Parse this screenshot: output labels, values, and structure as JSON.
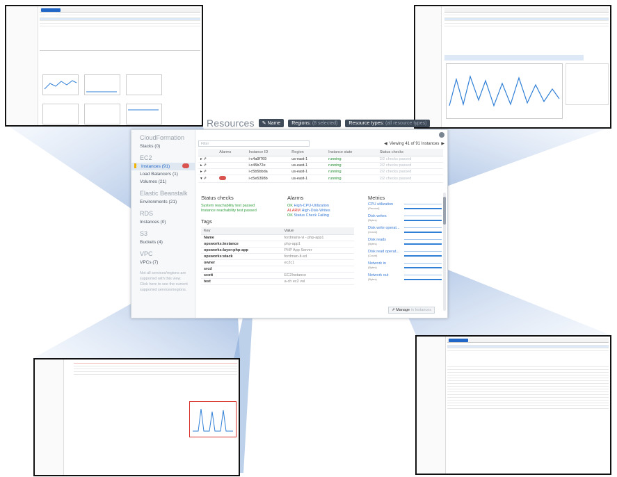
{
  "resources_bar": {
    "title": "Resources",
    "name_button": "Name",
    "regions_label": "Regions:",
    "regions_value": "(8 selected)",
    "resource_types_label": "Resource types:",
    "resource_types_value": "(all resource types)"
  },
  "nav": {
    "groups": [
      {
        "title": "CloudFormation",
        "items": [
          {
            "label": "Stacks (0)"
          }
        ]
      },
      {
        "title": "EC2",
        "items": [
          {
            "label": "Instances (91)",
            "selected": true,
            "alarm": true
          },
          {
            "label": "Load Balancers (1)"
          },
          {
            "label": "Volumes (21)"
          }
        ]
      },
      {
        "title": "Elastic Beanstalk",
        "items": [
          {
            "label": "Environments (21)"
          }
        ]
      },
      {
        "title": "RDS",
        "items": [
          {
            "label": "Instances (0)"
          }
        ]
      },
      {
        "title": "S3",
        "items": [
          {
            "label": "Buckets (4)"
          }
        ]
      },
      {
        "title": "VPC",
        "items": [
          {
            "label": "VPCs (7)"
          }
        ]
      }
    ],
    "blurb": "Not all services/regions are supported with this view. Click here to see the current supported services/regions."
  },
  "toolbar": {
    "filter_placeholder": "Filter",
    "viewing": "Viewing 41 of 91 Instances"
  },
  "instance_table": {
    "headers": [
      "Alarms",
      "Instance ID",
      "Region",
      "Instance state",
      "Status checks"
    ],
    "rows": [
      {
        "id": "i-c4a9f769",
        "region": "us-east-1",
        "state": "running",
        "status": "2/2 checks passed",
        "alarm": false
      },
      {
        "id": "i-c45b72e",
        "region": "us-east-1",
        "state": "running",
        "status": "2/2 checks passed",
        "alarm": false
      },
      {
        "id": "i-c5b5bbda",
        "region": "us-east-1",
        "state": "running",
        "status": "2/2 checks passed",
        "alarm": false
      },
      {
        "id": "i-c5e5398b",
        "region": "us-east-1",
        "state": "running",
        "status": "2/2 checks passed",
        "alarm": true
      }
    ]
  },
  "status_checks": {
    "title": "Status checks",
    "items": [
      "System reachability test passed",
      "Instance reachability test passed"
    ]
  },
  "alarms": {
    "title": "Alarms",
    "items": [
      {
        "state": "OK",
        "name": "High-CPU-Utilization"
      },
      {
        "state": "ALARM",
        "name": "High-Disk-Writes"
      },
      {
        "state": "OK",
        "name": "Status Check Failing"
      }
    ]
  },
  "tags": {
    "title": "Tags",
    "headers": [
      "Key",
      "Value"
    ],
    "rows": [
      {
        "key": "Name",
        "value": "fordmans-vi - php-app1"
      },
      {
        "key": "opsworks:instance",
        "value": "php-app1"
      },
      {
        "key": "opsworks:layer:php-app",
        "value": "PHP App Server"
      },
      {
        "key": "opsworks:stack",
        "value": "fordman-lt-sd"
      },
      {
        "key": "owner",
        "value": "ec2c1"
      },
      {
        "key": "srcd",
        "value": ""
      },
      {
        "key": "scott",
        "value": "EC2Instance"
      },
      {
        "key": "test",
        "value": "a-ch ec2 vol"
      }
    ]
  },
  "metrics": {
    "title": "Metrics",
    "items": [
      {
        "name": "CPU utilization",
        "unit": "(Percent)"
      },
      {
        "name": "Disk writes",
        "unit": "(Bytes)"
      },
      {
        "name": "Disk write operat...",
        "unit": "(Count)"
      },
      {
        "name": "Disk reads",
        "unit": "(Bytes)"
      },
      {
        "name": "Disk read operat...",
        "unit": "(Count)"
      },
      {
        "name": "Network in",
        "unit": "(Bytes)"
      },
      {
        "name": "Network out",
        "unit": "(Bytes)"
      }
    ]
  },
  "manage_button": "Manage",
  "manage_suffix": "in Instances",
  "colors": {
    "accent": "#1f66c7",
    "ok": "#2f9e3c",
    "alarm": "#d9312b",
    "ray": "#5b86c9"
  }
}
